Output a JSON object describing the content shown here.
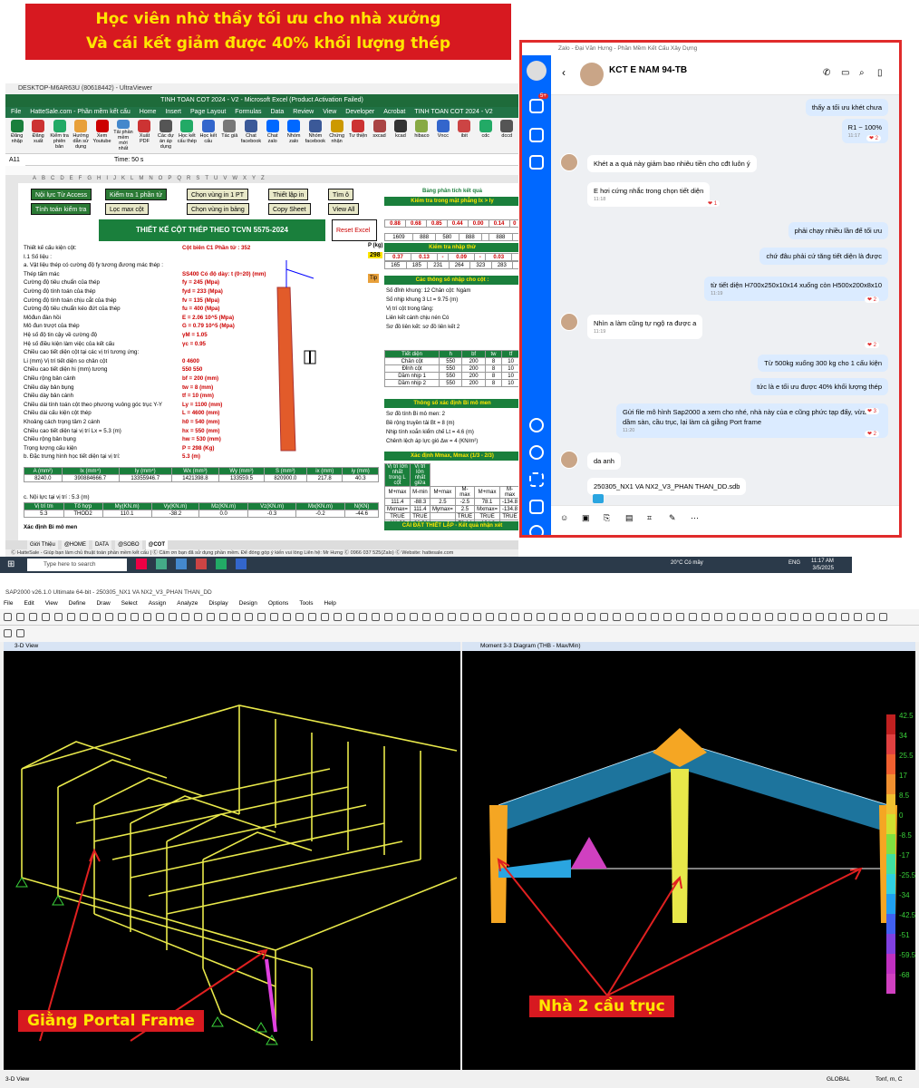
{
  "banner": {
    "line1": "Học viên nhờ thầy tối ưu cho nhà xưởng",
    "line2": "Và cái kết giảm được 40% khối lượng thép"
  },
  "remote": {
    "title": "DESKTOP-M6AR63U (80618442) - UltraViewer"
  },
  "excel": {
    "title": "TINH TOAN COT 2024 - V2 - Microsoft Excel (Product Activation Failed)",
    "tabs": [
      "File",
      "HatteSale.com - Phần mềm kết cấu",
      "Home",
      "Insert",
      "Page Layout",
      "Formulas",
      "Data",
      "Review",
      "View",
      "Developer",
      "Acrobat",
      "TINH TOAN COT 2024 - V2"
    ],
    "ribbon": [
      "Đăng nhập",
      "Đăng xuất",
      "Kiểm tra phiên bản",
      "Hướng dẫn sử dụng",
      "Xem Youtube",
      "Tải phần mềm mới nhất",
      "Xuất PDF",
      "Các dự án áp dụng",
      "Học kết cấu thép",
      "Học kết cấu",
      "Tác giả",
      "Chat facebook",
      "Chat zalo",
      "Nhóm zalo",
      "Nhóm facebook",
      "Chứng nhận",
      "Tư thiện",
      "sxcad",
      "kcad",
      "hibaco",
      "Vncc",
      "ibit",
      "cdc",
      "dccd"
    ],
    "cell_ref": "A11",
    "formula": "Time: 50 s",
    "sheet_title": "THIẾT KẾ CỘT THÉP THEO TCVN 5575-2024",
    "buttons": [
      "Nội lực Từ Access",
      "Kiểm tra 1 phần tử",
      "Chọn vùng in 1 PT",
      "Thiết lập in",
      "Tìm ô",
      "Tính toán kiểm tra",
      "Lọc max cột",
      "Chọn vùng in bảng",
      "Copy Sheet",
      "View All",
      "Reset Excel"
    ],
    "lines": [
      {
        "t": "Thiết kế cấu kiện cột:",
        "v": "Cột biên   C1      Phần tử : 352"
      },
      {
        "t": "I.1   Số liệu :",
        "v": ""
      },
      {
        "t": "a. Vật liệu thép có cường độ fy tương đương mác thép :",
        "v": ""
      },
      {
        "t": "Thép tấm mác",
        "v": "SS400    Có độ dày: t   (0÷20)  (mm)"
      },
      {
        "t": "Cường độ tiêu chuẩn của thép",
        "v": "fy = 245  (Mpa)"
      },
      {
        "t": "Cường độ tính toán của thép",
        "v": "fyd = 233  (Mpa)"
      },
      {
        "t": "Cường độ tính toán chịu cắt của thép",
        "v": "fv = 135  (Mpa)"
      },
      {
        "t": "Cường độ tiêu chuẩn kéo đứt của thép",
        "v": "fu = 400  (Mpa)"
      },
      {
        "t": "Môđun đàn hồi",
        "v": "E = 2.06  10^5 (Mpa)"
      },
      {
        "t": "Mô đun trượt của thép",
        "v": "G = 0.79  10^5 (Mpa)"
      },
      {
        "t": "Hệ số độ tin cậy về cường độ",
        "v": "γM = 1.05"
      },
      {
        "t": "Hệ số điều kiện làm việc của kết cấu",
        "v": "γc = 0.95"
      },
      {
        "t": "Chiều cao tiết diện cột tại các vị trí tương ứng:",
        "v": ""
      },
      {
        "t": "Li (mm) Vị trí tiết diện so chân cột",
        "v": "0    4600"
      },
      {
        "t": "Chiều cao tiết diện hi (mm) tương",
        "v": "550   550"
      },
      {
        "t": "Chiều rộng bản cánh",
        "v": "bf = 200  (mm)"
      },
      {
        "t": "Chiều dày bản bụng",
        "v": "tw = 8  (mm)"
      },
      {
        "t": "Chiều dày bản cánh",
        "v": "tf = 10  (mm)"
      },
      {
        "t": "Chiều dài tính toán cột theo phương vuông góc trục Y-Y",
        "v": "Ly = 1100  (mm)"
      },
      {
        "t": "Chiều dài cấu kiện cột thép",
        "v": "L = 4600  (mm)"
      },
      {
        "t": "Khoảng cách trọng tâm 2 cánh",
        "v": "h0 = 540  (mm)"
      },
      {
        "t": "Chiều cao tiết diện tại vị trí Lx = 5.3 (m)",
        "v": "hx = 550  (mm)"
      },
      {
        "t": "Chiều rộng bản bụng",
        "v": "hw = 530  (mm)"
      },
      {
        "t": "Trọng lượng cấu kiện",
        "v": "P = 298  (Kg)"
      },
      {
        "t": "b. Đặc trưng hình học tiết diện tại vị trí:",
        "v": "5.3  (m)"
      }
    ],
    "geo_table": {
      "headers": [
        "A (mm²)",
        "Ix (mm⁴)",
        "Iy (mm⁴)",
        "Wx (mm³)",
        "Wy (mm³)",
        "S (mm³)",
        "ix (mm)",
        "iy (mm)"
      ],
      "values": [
        "8240.0",
        "390884666.7",
        "13355946.7",
        "1421398.8",
        "133559.5",
        "820900.0",
        "217.8",
        "40.3"
      ]
    },
    "force_title": "c. Nội lực tại vị trí :   5.3  (m)",
    "force_table": {
      "headers": [
        "Vị trí tm",
        "Tổ hợp",
        "My(KN.m)",
        "Vy(KN.m)",
        "Mz(KN.m)",
        "Vz(KN.m)",
        "Mx(KN.m)",
        "N(KN)"
      ],
      "values": [
        "5.3",
        "THOD2",
        "110.1",
        "-38.2",
        "0.0",
        "-0.3",
        "-0.2",
        "-44.6"
      ]
    },
    "moment_label": "Xác định Bi mô men",
    "right": {
      "h1": "Bảng phân tích kết quả",
      "h2": "Kiểm tra trong mặt phẳng Ix > Iy",
      "r1": [
        "0.88",
        "0.68",
        "0.85",
        "0.44",
        "0.00",
        "0.14",
        "0"
      ],
      "r2": [
        "1609",
        "888",
        "580",
        "888",
        "",
        "888",
        ""
      ],
      "h3": "Kiểm tra nhập thử",
      "p_label": "P (kg)",
      "p_val": "298",
      "r3": [
        "0.37",
        "0.13",
        "-",
        "0.09",
        "-",
        "0.03",
        ""
      ],
      "r4": [
        "165",
        "185",
        "231",
        "264",
        "323",
        "283",
        ""
      ],
      "tip": "Tip",
      "h4": "Các thông số nhập cho cột :",
      "params": [
        "Số đỉnh khung:  12    Chân cột: Ngàm",
        "Số nhịp khung   3    Lt = 9.75 (m)",
        "Vị trí cột trong tầng:",
        "Liên kết cánh chịu nén   Có",
        "Sơ đồ liên kết:   sơ đồ liên kết 2"
      ],
      "sect_headers": [
        "Tiết diện",
        "h",
        "bf",
        "tw",
        "tf"
      ],
      "sect_rows": [
        [
          "Chân cột",
          "550",
          "200",
          "8",
          "10"
        ],
        [
          "Đỉnh cột",
          "550",
          "200",
          "8",
          "10"
        ],
        [
          "Dầm nhịp 1",
          "550",
          "200",
          "8",
          "10"
        ],
        [
          "Dầm nhịp 2",
          "550",
          "200",
          "8",
          "10"
        ]
      ],
      "h5": "Thông số xác định Bi mô men",
      "bi": [
        "Sơ đồ tính Bi mô men:   2",
        "Bề rộng truyền tải   Bt = 8  (m)",
        "Nhịp tính xoắn kiểm chế   Lt = 4.6  (m)",
        "Chênh lệch áp lực gió   Δw = 4  (KN/m²)"
      ],
      "h6": "Xác định Mmax, Mmax (1/3 - 2/3)",
      "mm_sub": [
        "Vị trí lớn nhất trong L cột",
        "Vị trí lớn nhất giữa"
      ],
      "mm_head": [
        "M+max",
        "M-min",
        "M+max",
        "M-max",
        "M+max",
        "M-max"
      ],
      "mm_r1": [
        "111.4",
        "-88.3",
        "2.5",
        "-2.5",
        "78.1",
        "-134.8"
      ],
      "mm_r2": [
        "Mxmax=",
        "111.4",
        "Mymax=",
        "2.5",
        "Mxmax=",
        "-134.8"
      ],
      "mm_r3": [
        "TRUE",
        "TRUE",
        "",
        "TRUE",
        "TRUE",
        "TRUE"
      ],
      "mm_r4": [
        "111.38",
        "-88.31",
        "",
        "78.14",
        "-134.8",
        ""
      ],
      "h7": "CÀI ĐẶT THIẾT LẬP - Kết quả nhận xét"
    },
    "sheet_tabs": [
      "Giới Thiệu",
      "@HOME",
      "DATA",
      "@SOBO",
      "@COT"
    ],
    "status": "Ⓒ HatteSale - Giúp bạn làm chủ thuật toán phần mềm kết cấu | Ⓒ Cảm ơn bạn đã sử dụng phần mềm. Để đóng góp ý kiến vui lòng Liên hệ: Mr Hưng Ⓒ 0966 037 525(Zalo) Ⓒ Website: hattesale.com"
  },
  "zalo": {
    "title": "Zalo - Đại Văn Hưng - Phần Mềm Kết Cấu Xây Dựng",
    "chat_name": "KCT E NAM 94-TB",
    "badge": "5+",
    "messages": [
      {
        "side": "me",
        "text": "thấy a tối ưu khét chưa",
        "time": ""
      },
      {
        "side": "me",
        "text": "R1 ~ 100%",
        "time": "11:17"
      },
      {
        "side": "them",
        "text": "Khét a a quá này giảm bao nhiêu tiền cho cđt luôn ý",
        "time": ""
      },
      {
        "side": "them",
        "text": "E hơi cứng nhắc trong chọn tiết diện",
        "time": "11:18"
      },
      {
        "side": "me",
        "text": "phải chạy nhiều lần để tối ưu",
        "time": ""
      },
      {
        "side": "me",
        "text": "chứ đâu phải cứ tăng tiết diện là được",
        "time": ""
      },
      {
        "side": "me",
        "text": "từ tiết diện H700x250x10x14 xuống còn H500x200x8x10",
        "time": "11:19"
      },
      {
        "side": "them",
        "text": "Nhìn a làm cũng tự ngộ ra được a",
        "time": "11:19"
      },
      {
        "side": "me",
        "text": "Từ 500kg xuống 300 kg cho 1 cấu kiện",
        "time": ""
      },
      {
        "side": "me",
        "text": "tức là e tối ưu được 40% khối lượng thép",
        "time": ""
      },
      {
        "side": "me",
        "text": "Gửi file mô hình Sap2000 a xem cho nhé, nhà này của e cũng phức tạp đấy, vừa có dầm sàn, cầu trục, lại làm cả giằng Port frame",
        "time": "11:20"
      },
      {
        "side": "them",
        "text": "da anh",
        "time": ""
      },
      {
        "side": "them",
        "text": "250305_NX1 VA NX2_V3_PHAN THAN_DD.sdb",
        "time": ""
      }
    ],
    "reactions": {
      "r1": "2",
      "r2": "1",
      "r3": "2",
      "r4": "2",
      "r5": "3",
      "r6": "2"
    }
  },
  "taskbar": {
    "search": "Type here to search",
    "weather": "20°C  Có mây",
    "lang": "ENG",
    "time": "11:17 AM",
    "date": "3/5/2025"
  },
  "sap": {
    "title": "SAP2000 v26.1.0 Ultimate 64-bit - 250305_NX1 VA NX2_V3_PHAN THAN_DD",
    "menu": [
      "File",
      "Edit",
      "View",
      "Define",
      "Draw",
      "Select",
      "Assign",
      "Analyze",
      "Display",
      "Design",
      "Options",
      "Tools",
      "Help"
    ],
    "view1": "3-D View",
    "view2": "Moment 3-3 Diagram  (THB - Max/Min)",
    "label1": "Giằng Portal Frame",
    "label2": "Nhà 2 cầu trục",
    "scale": [
      "42.5",
      "34",
      "25.5",
      "17",
      "8.5",
      "0",
      "-8.5",
      "-17",
      "-25.5",
      "-34",
      "-42.5",
      "-51",
      "-59.5",
      "-68"
    ],
    "status_left": "3-D View",
    "status_global": "GLOBAL",
    "status_units": "Tonf, m, C"
  },
  "colors": {
    "red": "#d71920",
    "yellow": "#ffe600",
    "green": "#1a7f3c",
    "zalo": "#0068ff"
  }
}
